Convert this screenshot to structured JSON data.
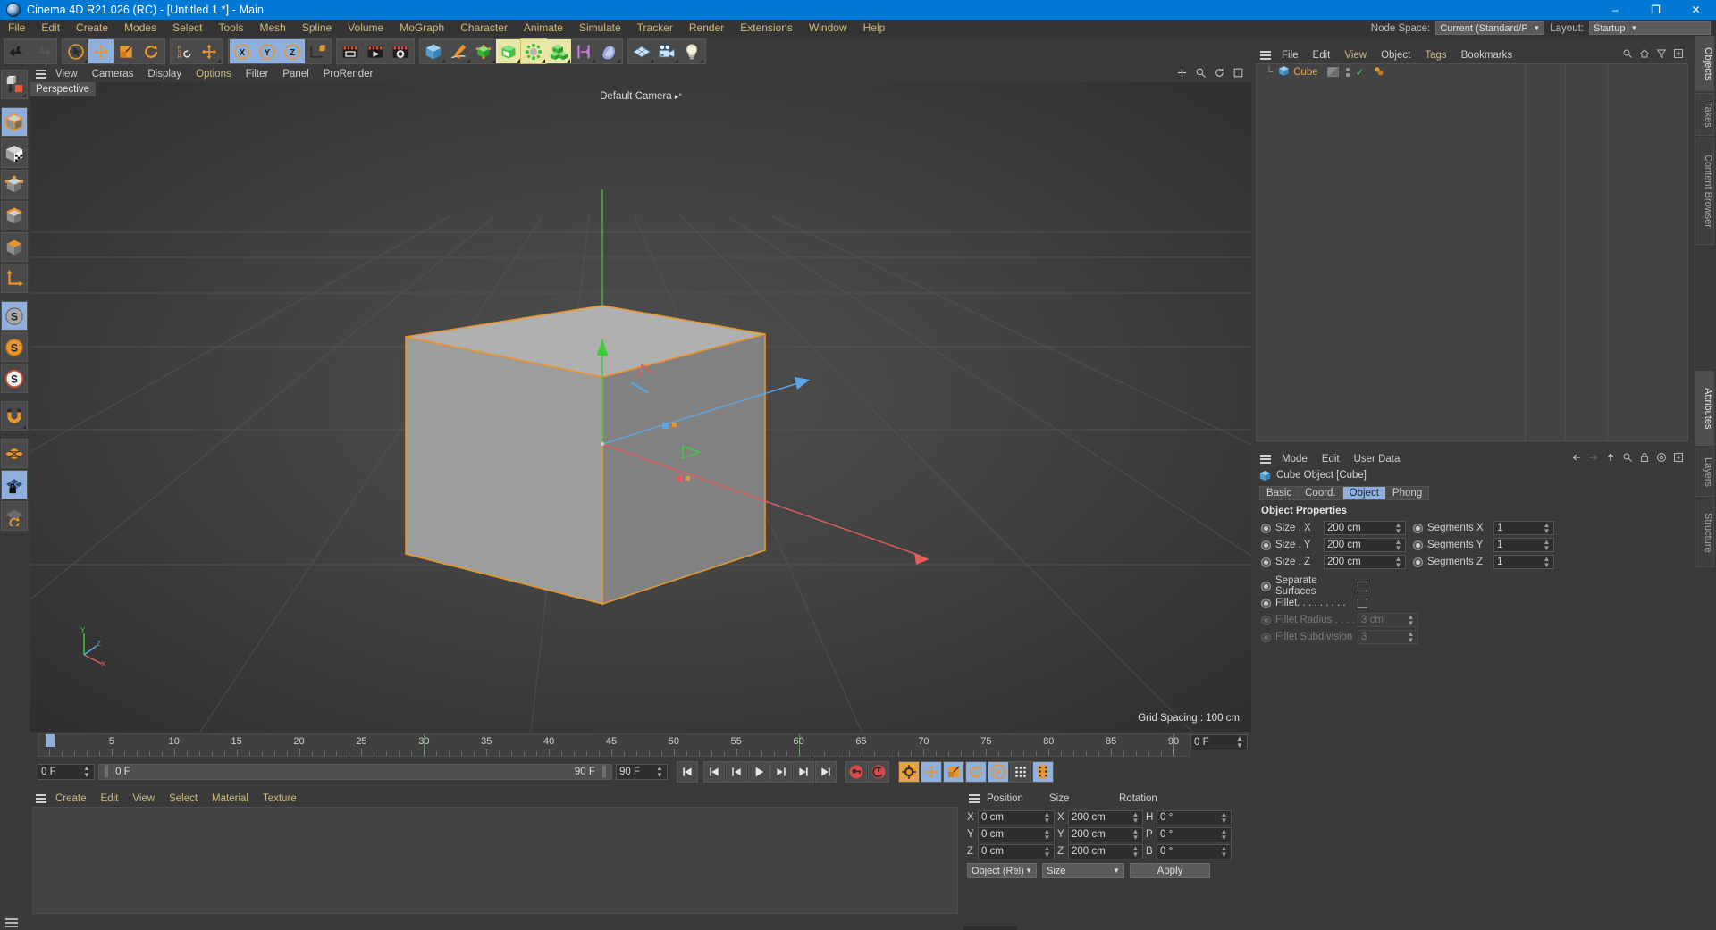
{
  "window": {
    "title": "Cinema 4D R21.026 (RC) - [Untitled 1 *] - Main",
    "app_icon": "cinema4d-logo-icon",
    "minimize": "–",
    "maximize": "❐",
    "close": "✕"
  },
  "menubar": {
    "items": [
      "File",
      "Edit",
      "Create",
      "Modes",
      "Select",
      "Tools",
      "Mesh",
      "Spline",
      "Volume",
      "MoGraph",
      "Character",
      "Animate",
      "Simulate",
      "Tracker",
      "Render",
      "Extensions",
      "Window",
      "Help"
    ],
    "node_space_label": "Node Space:",
    "node_space_value": "Current (Standard/Physical)",
    "layout_label": "Layout:",
    "layout_value": "Startup"
  },
  "toolbar": {
    "groups": [
      {
        "name": "history",
        "buttons": [
          {
            "name": "undo-button",
            "icon": "undo-icon",
            "state": "normal"
          },
          {
            "name": "redo-button",
            "icon": "redo-icon",
            "state": "disabled"
          }
        ]
      },
      {
        "name": "transform",
        "buttons": [
          {
            "name": "live-selection-button",
            "icon": "select-cursor-icon",
            "state": "corner"
          },
          {
            "name": "move-button",
            "icon": "move-arrows-icon",
            "state": "active"
          },
          {
            "name": "scale-button",
            "icon": "scale-box-icon",
            "state": "normal"
          },
          {
            "name": "rotate-button",
            "icon": "rotate-arc-icon",
            "state": "normal"
          }
        ]
      },
      {
        "name": "psr",
        "buttons": [
          {
            "name": "psr-reset-button",
            "icon": "psr-icon",
            "state": "normal"
          },
          {
            "name": "world-object-axis-button",
            "icon": "move-arrows-icon",
            "state": "corner"
          }
        ]
      },
      {
        "name": "axis-lock",
        "buttons": [
          {
            "name": "x-axis-button",
            "icon": "x-circle-icon",
            "state": "active"
          },
          {
            "name": "y-axis-button",
            "icon": "y-circle-icon",
            "state": "active"
          },
          {
            "name": "z-axis-button",
            "icon": "z-circle-icon",
            "state": "active"
          },
          {
            "name": "world-coordinate-button",
            "icon": "world-axis-cube-icon",
            "state": "normal"
          }
        ]
      },
      {
        "name": "render",
        "buttons": [
          {
            "name": "render-view-button",
            "icon": "clapper-view-icon",
            "state": "normal"
          },
          {
            "name": "render-to-picture-viewer-button",
            "icon": "clapper-play-icon",
            "state": "normal"
          },
          {
            "name": "render-settings-button",
            "icon": "clapper-gear-icon",
            "state": "normal"
          }
        ]
      },
      {
        "name": "objects",
        "buttons": [
          {
            "name": "add-cube-button",
            "icon": "blue-cube-icon",
            "state": "corner"
          },
          {
            "name": "add-spline-button",
            "icon": "pen-spline-icon",
            "state": "corner"
          },
          {
            "name": "add-generator-button",
            "icon": "green-nurbs-icon",
            "state": "corner"
          },
          {
            "name": "add-deformer-button",
            "icon": "bend-cube-icon",
            "state": "highlight"
          },
          {
            "name": "add-scene-object-button",
            "icon": "environment-icon",
            "state": "highlight-sel"
          },
          {
            "name": "add-mograph-button",
            "icon": "cloner-cubes-icon",
            "state": "highlight"
          },
          {
            "name": "add-field-button",
            "icon": "field-icon",
            "state": "corner"
          },
          {
            "name": "add-material-button",
            "icon": "material-blob-icon",
            "state": "corner"
          }
        ]
      },
      {
        "name": "misc",
        "buttons": [
          {
            "name": "add-plane-button",
            "icon": "grid-plane-icon",
            "state": "corner"
          },
          {
            "name": "add-camera-button",
            "icon": "camera-icon",
            "state": "corner"
          },
          {
            "name": "add-light-button",
            "icon": "light-bulb-icon",
            "state": "corner"
          }
        ]
      }
    ]
  },
  "left_toolbar": {
    "buttons": [
      {
        "name": "make-editable-button",
        "icon": "make-editable-icon",
        "state": "corner"
      },
      {
        "name": "model-mode-button",
        "icon": "model-cube-icon",
        "state": "active"
      },
      {
        "name": "texture-mode-button",
        "icon": "texture-cube-icon",
        "state": "normal"
      },
      {
        "name": "points-mode-button",
        "icon": "points-cube-icon",
        "state": "normal"
      },
      {
        "name": "edges-mode-button",
        "icon": "edges-cube-icon",
        "state": "normal"
      },
      {
        "name": "polygons-mode-button",
        "icon": "polygons-cube-icon",
        "state": "normal"
      },
      {
        "name": "axis-mode-button",
        "icon": "axis-l-icon",
        "state": "normal"
      },
      {
        "name": "enable-axis-button",
        "icon": "s-gray-icon",
        "state": "active"
      },
      {
        "name": "workplane-button",
        "icon": "s-orange-icon",
        "state": "normal"
      },
      {
        "name": "workplane-lock-button",
        "icon": "s-white-icon",
        "state": "normal"
      },
      {
        "name": "snap-magnet-button",
        "icon": "magnet-icon",
        "state": "corner"
      },
      {
        "name": "grid-button",
        "icon": "orange-grid-icon",
        "state": "normal"
      },
      {
        "name": "workplane-lock2-button",
        "icon": "grid-lock-icon",
        "state": "active"
      },
      {
        "name": "workplane-rotate-button",
        "icon": "grid-rotate-icon",
        "state": "normal"
      }
    ]
  },
  "viewport": {
    "menu": [
      "View",
      "Cameras",
      "Display",
      "Options",
      "Filter",
      "Panel",
      "ProRender"
    ],
    "active_menu": "Options",
    "label": "Perspective",
    "camera_label": "Default Camera",
    "grid_spacing": "Grid Spacing : 100 cm",
    "axis_labels": {
      "x": "X",
      "y": "Y",
      "z": "Z"
    },
    "object_outline_color": "#e8952e"
  },
  "timeline": {
    "ruler_ticks": [
      0,
      5,
      10,
      15,
      20,
      25,
      30,
      35,
      40,
      45,
      50,
      55,
      60,
      65,
      70,
      75,
      80,
      85,
      90
    ],
    "current_frame_field": "0 F",
    "current_frame_bar": "0 F",
    "end_frame_bar": "90 F",
    "end_frame_field": "90 F",
    "preview_end_field": "0 F",
    "playhead_frame": 0,
    "transport": [
      {
        "name": "go-to-start-button",
        "icon": "skip-start-icon"
      },
      {
        "name": "go-to-previous-key-button",
        "icon": "prev-key-icon"
      },
      {
        "name": "step-back-button",
        "icon": "step-back-icon"
      },
      {
        "name": "play-button",
        "icon": "play-icon"
      },
      {
        "name": "step-forward-button",
        "icon": "step-forward-icon"
      },
      {
        "name": "go-to-next-key-button",
        "icon": "next-key-icon"
      },
      {
        "name": "go-to-end-button",
        "icon": "skip-end-icon"
      }
    ],
    "record_buttons": [
      {
        "name": "record-active-objects-button",
        "icon": "record-key-icon"
      },
      {
        "name": "autokeying-button",
        "icon": "autokey-icon"
      }
    ],
    "keyframe_toggles": [
      {
        "name": "keyframe-selection-button",
        "icon": "key-gear-icon",
        "state": "on2"
      },
      {
        "name": "position-key-button",
        "icon": "move-arrows-icon",
        "state": "on"
      },
      {
        "name": "scale-key-button",
        "icon": "scale-box-icon",
        "state": "on"
      },
      {
        "name": "rotation-key-button",
        "icon": "rotate-arc-icon",
        "state": "on"
      },
      {
        "name": "parameter-key-button",
        "icon": "p-circle-icon",
        "state": "on"
      },
      {
        "name": "point-level-animation-button",
        "icon": "pla-dots-icon",
        "state": "normal"
      },
      {
        "name": "timeline-mode-button",
        "icon": "film-strip-icon",
        "state": "on"
      }
    ]
  },
  "material_manager": {
    "menu": [
      "Create",
      "Edit",
      "View",
      "Select",
      "Material",
      "Texture"
    ]
  },
  "coordinates": {
    "columns": [
      "Position",
      "Size",
      "Rotation"
    ],
    "rows": [
      {
        "plabel": "X",
        "pvalue": "0 cm",
        "slabel": "X",
        "svalue": "200 cm",
        "rlabel": "H",
        "rvalue": "0 °"
      },
      {
        "plabel": "Y",
        "pvalue": "0 cm",
        "slabel": "Y",
        "svalue": "200 cm",
        "rlabel": "P",
        "rvalue": "0 °"
      },
      {
        "plabel": "Z",
        "pvalue": "0 cm",
        "slabel": "Z",
        "svalue": "200 cm",
        "rlabel": "B",
        "rvalue": "0 °"
      }
    ],
    "mode_select": "Object (Rel)",
    "size_select": "Size",
    "apply_button": "Apply"
  },
  "object_manager": {
    "menu": [
      "File",
      "Edit",
      "View",
      "Object",
      "Tags",
      "Bookmarks"
    ],
    "yellow_menu": [
      "View",
      "Tags"
    ],
    "icons": [
      "search-icon",
      "home-icon",
      "filter-icon",
      "add-icon"
    ],
    "objects": [
      {
        "name": "Cube",
        "icon": "blue-cube-icon",
        "visible_dot": true,
        "tags": [
          "phong-tag"
        ]
      }
    ]
  },
  "attributes": {
    "menu": [
      "Mode",
      "Edit",
      "User Data"
    ],
    "icons": [
      "back-arrow-icon",
      "forward-arrow-icon",
      "up-arrow-icon",
      "search-icon",
      "lock-icon",
      "target-icon",
      "add-icon"
    ],
    "object_title": "Cube Object [Cube]",
    "object_icon": "blue-cube-icon",
    "tabs": [
      "Basic",
      "Coord.",
      "Object",
      "Phong"
    ],
    "selected_tab": "Object",
    "section_title": "Object Properties",
    "properties": [
      {
        "label": "Size . X",
        "value": "200 cm",
        "label2": "Segments X",
        "value2": "1",
        "disabled": false
      },
      {
        "label": "Size . Y",
        "value": "200 cm",
        "label2": "Segments Y",
        "value2": "1",
        "disabled": false
      },
      {
        "label": "Size . Z",
        "value": "200 cm",
        "label2": "Segments Z",
        "value2": "1",
        "disabled": false
      }
    ],
    "checkboxes": [
      {
        "label": "Separate Surfaces",
        "checked": false,
        "disabled": false
      },
      {
        "label": "Fillet. . . . . . . . .",
        "checked": false,
        "disabled": false
      }
    ],
    "disabled_fields": [
      {
        "label": "Fillet Radius . . . .",
        "value": "3 cm"
      },
      {
        "label": "Fillet Subdivision",
        "value": "3"
      }
    ]
  },
  "edge_tabs": {
    "top": [
      {
        "label": "Objects",
        "selected": true
      },
      {
        "label": "Takes",
        "selected": false
      },
      {
        "label": "Content Browser",
        "selected": false
      }
    ],
    "bottom": [
      {
        "label": "Attributes",
        "selected": true
      },
      {
        "label": "Layers",
        "selected": false
      },
      {
        "label": "Structure",
        "selected": false
      }
    ]
  }
}
